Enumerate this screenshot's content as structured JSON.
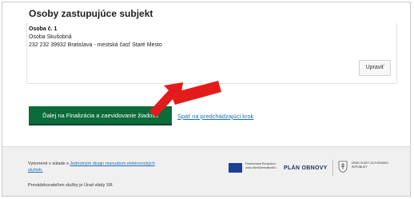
{
  "section": {
    "title": "Osoby zastupujúce subjekt"
  },
  "person": {
    "heading": "Osoba č. 1",
    "name": "Osoba Skušobná",
    "address": "232 232 39932 Bratislava - mestská časť Staré Mesto"
  },
  "actions": {
    "edit_label": "Upraviť",
    "continue_label": "Ďalej na Finalizácia a zaevidovanie žiadosti",
    "back_label": "Späť na predchádzajúci krok"
  },
  "footer": {
    "created_prefix": "Vytvorené v súlade s",
    "created_link": "Jednotným dizajn manuálom elektronických služieb.",
    "operator": "Prevádzkovateľom služby je Úrad vlády SR.",
    "eu_text": "Financované Európskou úniou NextGenerationEU",
    "plan_logo": "PLÁN OBNOVY",
    "gov_text": "ÚRAD VLÁDY SLOVENSKEJ REPUBLIKY"
  },
  "colors": {
    "primary_button": "#0b6b3a",
    "link": "#1d70b8",
    "annotation_arrow": "#e31b1b",
    "footer_bg": "#f0f0f0"
  }
}
